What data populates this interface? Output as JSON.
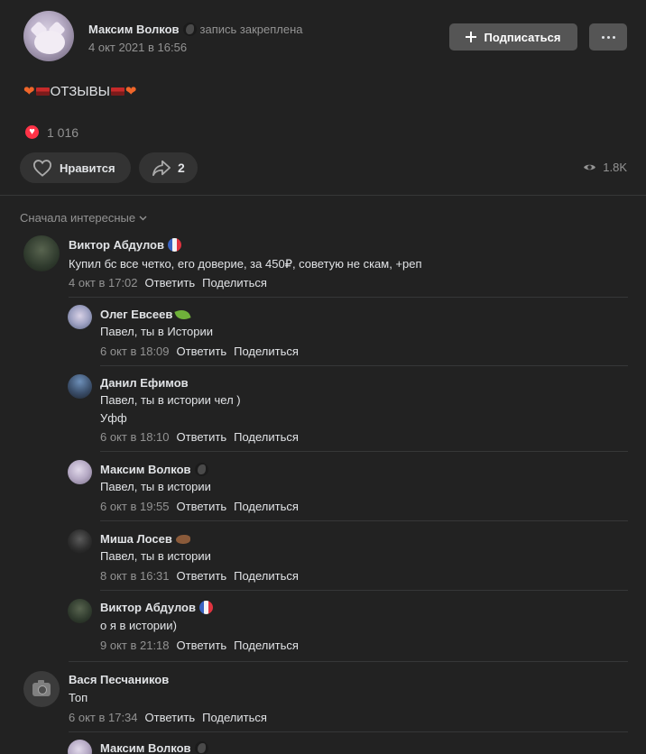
{
  "post": {
    "author": "Максим Волков",
    "pinned": "запись закреплена",
    "date": "4 окт 2021 в 16:56",
    "subscribe_label": "Подписаться",
    "text": "ОТЗЫВЫ",
    "reactions_count": "1 016",
    "like_label": "Нравится",
    "share_count": "2",
    "views": "1.8K"
  },
  "comments_section": {
    "sort_label": "Сначала интересные",
    "reply_label": "Ответить",
    "share_label": "Поделиться"
  },
  "comments": [
    {
      "author": "Виктор Абдулов",
      "badge": "flag-fr",
      "text": "Купил бс все четко, его доверие, за 450₽, советую не скам, +реп",
      "date": "4 окт в 17:02"
    },
    {
      "author": "Олег Евсеев",
      "badge": "leaf",
      "text": "Павел, ты в Истории",
      "date": "6 окт в 18:09"
    },
    {
      "author": "Данил Ефимов",
      "badge": "",
      "text": "Павел, ты в истории чел )",
      "text2": "Уфф",
      "date": "6 окт в 18:10"
    },
    {
      "author": "Максим Волков",
      "badge": "author-badge",
      "text": "Павел, ты в истории",
      "date": "6 окт в 19:55"
    },
    {
      "author": "Миша Лосев",
      "badge": "hedgehog",
      "text": "Павел, ты в истории",
      "date": "8 окт в 16:31"
    },
    {
      "author": "Виктор Абдулов",
      "badge": "flag-fr",
      "text": "о я в истории)",
      "date": "9 окт в 21:18"
    },
    {
      "author": "Вася Песчаников",
      "badge": "",
      "text": "Топ",
      "date": "6 окт в 17:34"
    },
    {
      "author": "Максим Волков",
      "badge": "author-badge"
    }
  ]
}
